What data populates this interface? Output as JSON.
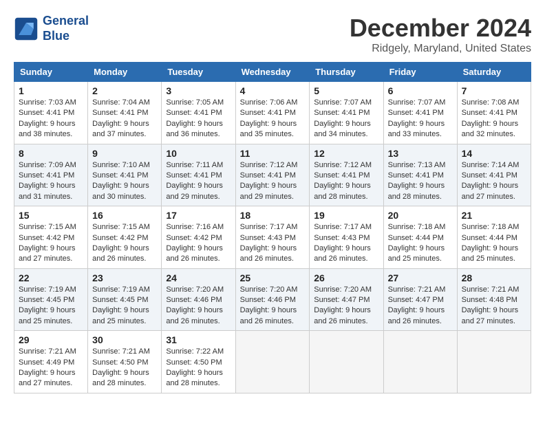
{
  "header": {
    "logo_line1": "General",
    "logo_line2": "Blue",
    "month_year": "December 2024",
    "location": "Ridgely, Maryland, United States"
  },
  "weekdays": [
    "Sunday",
    "Monday",
    "Tuesday",
    "Wednesday",
    "Thursday",
    "Friday",
    "Saturday"
  ],
  "weeks": [
    [
      {
        "day": "1",
        "sunrise": "7:03 AM",
        "sunset": "4:41 PM",
        "daylight": "9 hours and 38 minutes."
      },
      {
        "day": "2",
        "sunrise": "7:04 AM",
        "sunset": "4:41 PM",
        "daylight": "9 hours and 37 minutes."
      },
      {
        "day": "3",
        "sunrise": "7:05 AM",
        "sunset": "4:41 PM",
        "daylight": "9 hours and 36 minutes."
      },
      {
        "day": "4",
        "sunrise": "7:06 AM",
        "sunset": "4:41 PM",
        "daylight": "9 hours and 35 minutes."
      },
      {
        "day": "5",
        "sunrise": "7:07 AM",
        "sunset": "4:41 PM",
        "daylight": "9 hours and 34 minutes."
      },
      {
        "day": "6",
        "sunrise": "7:07 AM",
        "sunset": "4:41 PM",
        "daylight": "9 hours and 33 minutes."
      },
      {
        "day": "7",
        "sunrise": "7:08 AM",
        "sunset": "4:41 PM",
        "daylight": "9 hours and 32 minutes."
      }
    ],
    [
      {
        "day": "8",
        "sunrise": "7:09 AM",
        "sunset": "4:41 PM",
        "daylight": "9 hours and 31 minutes."
      },
      {
        "day": "9",
        "sunrise": "7:10 AM",
        "sunset": "4:41 PM",
        "daylight": "9 hours and 30 minutes."
      },
      {
        "day": "10",
        "sunrise": "7:11 AM",
        "sunset": "4:41 PM",
        "daylight": "9 hours and 29 minutes."
      },
      {
        "day": "11",
        "sunrise": "7:12 AM",
        "sunset": "4:41 PM",
        "daylight": "9 hours and 29 minutes."
      },
      {
        "day": "12",
        "sunrise": "7:12 AM",
        "sunset": "4:41 PM",
        "daylight": "9 hours and 28 minutes."
      },
      {
        "day": "13",
        "sunrise": "7:13 AM",
        "sunset": "4:41 PM",
        "daylight": "9 hours and 28 minutes."
      },
      {
        "day": "14",
        "sunrise": "7:14 AM",
        "sunset": "4:41 PM",
        "daylight": "9 hours and 27 minutes."
      }
    ],
    [
      {
        "day": "15",
        "sunrise": "7:15 AM",
        "sunset": "4:42 PM",
        "daylight": "9 hours and 27 minutes."
      },
      {
        "day": "16",
        "sunrise": "7:15 AM",
        "sunset": "4:42 PM",
        "daylight": "9 hours and 26 minutes."
      },
      {
        "day": "17",
        "sunrise": "7:16 AM",
        "sunset": "4:42 PM",
        "daylight": "9 hours and 26 minutes."
      },
      {
        "day": "18",
        "sunrise": "7:17 AM",
        "sunset": "4:43 PM",
        "daylight": "9 hours and 26 minutes."
      },
      {
        "day": "19",
        "sunrise": "7:17 AM",
        "sunset": "4:43 PM",
        "daylight": "9 hours and 26 minutes."
      },
      {
        "day": "20",
        "sunrise": "7:18 AM",
        "sunset": "4:44 PM",
        "daylight": "9 hours and 25 minutes."
      },
      {
        "day": "21",
        "sunrise": "7:18 AM",
        "sunset": "4:44 PM",
        "daylight": "9 hours and 25 minutes."
      }
    ],
    [
      {
        "day": "22",
        "sunrise": "7:19 AM",
        "sunset": "4:45 PM",
        "daylight": "9 hours and 25 minutes."
      },
      {
        "day": "23",
        "sunrise": "7:19 AM",
        "sunset": "4:45 PM",
        "daylight": "9 hours and 25 minutes."
      },
      {
        "day": "24",
        "sunrise": "7:20 AM",
        "sunset": "4:46 PM",
        "daylight": "9 hours and 26 minutes."
      },
      {
        "day": "25",
        "sunrise": "7:20 AM",
        "sunset": "4:46 PM",
        "daylight": "9 hours and 26 minutes."
      },
      {
        "day": "26",
        "sunrise": "7:20 AM",
        "sunset": "4:47 PM",
        "daylight": "9 hours and 26 minutes."
      },
      {
        "day": "27",
        "sunrise": "7:21 AM",
        "sunset": "4:47 PM",
        "daylight": "9 hours and 26 minutes."
      },
      {
        "day": "28",
        "sunrise": "7:21 AM",
        "sunset": "4:48 PM",
        "daylight": "9 hours and 27 minutes."
      }
    ],
    [
      {
        "day": "29",
        "sunrise": "7:21 AM",
        "sunset": "4:49 PM",
        "daylight": "9 hours and 27 minutes."
      },
      {
        "day": "30",
        "sunrise": "7:21 AM",
        "sunset": "4:50 PM",
        "daylight": "9 hours and 28 minutes."
      },
      {
        "day": "31",
        "sunrise": "7:22 AM",
        "sunset": "4:50 PM",
        "daylight": "9 hours and 28 minutes."
      },
      null,
      null,
      null,
      null
    ]
  ]
}
